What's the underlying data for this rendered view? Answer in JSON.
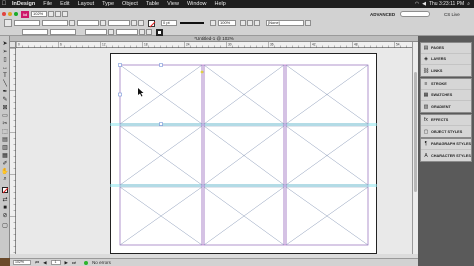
{
  "menubar": {
    "apple": "",
    "items": [
      "InDesign",
      "File",
      "Edit",
      "Layout",
      "Type",
      "Object",
      "Table",
      "View",
      "Window",
      "Help"
    ],
    "clock": "Thu 3:23:11 PM"
  },
  "control_bar": {
    "zoom": "102%",
    "workspace": "ADVANCED",
    "stroke_weight": "0 pt",
    "percent": "100%",
    "search_placeholder": "",
    "cs_live": "CS Live",
    "style": "[None]"
  },
  "document": {
    "tab_title": "*Untitled-1 @ 102%",
    "ruler_ticks": [
      "0",
      "6",
      "12",
      "18",
      "24",
      "30",
      "36",
      "42",
      "48",
      "54"
    ]
  },
  "status": {
    "page": "1",
    "preflight": "No errors"
  },
  "panels": {
    "group1": [
      {
        "icon": "pages-icon",
        "glyph": "▤",
        "label": "PAGES"
      },
      {
        "icon": "layers-icon",
        "glyph": "◈",
        "label": "LAYERS"
      },
      {
        "icon": "links-icon",
        "glyph": "⛓",
        "label": "LINKS"
      }
    ],
    "group2": [
      {
        "icon": "stroke-icon",
        "glyph": "≡",
        "label": "STROKE"
      },
      {
        "icon": "swatches-icon",
        "glyph": "▦",
        "label": "SWATCHES"
      },
      {
        "icon": "gradient-icon",
        "glyph": "▥",
        "label": "GRADIENT"
      }
    ],
    "group3": [
      {
        "icon": "effects-icon",
        "glyph": "fx",
        "label": "EFFECTS"
      },
      {
        "icon": "object-styles-icon",
        "glyph": "▢",
        "label": "OBJECT STYLES"
      }
    ],
    "group4": [
      {
        "icon": "paragraph-styles-icon",
        "glyph": "¶",
        "label": "PARAGRAPH STYLES"
      },
      {
        "icon": "character-styles-icon",
        "glyph": "A",
        "label": "CHARACTER STYLES"
      }
    ]
  },
  "colors": {
    "frame_border": "#c04ad0",
    "guide": "#8ee6ee",
    "margin": "#c04ad0"
  }
}
